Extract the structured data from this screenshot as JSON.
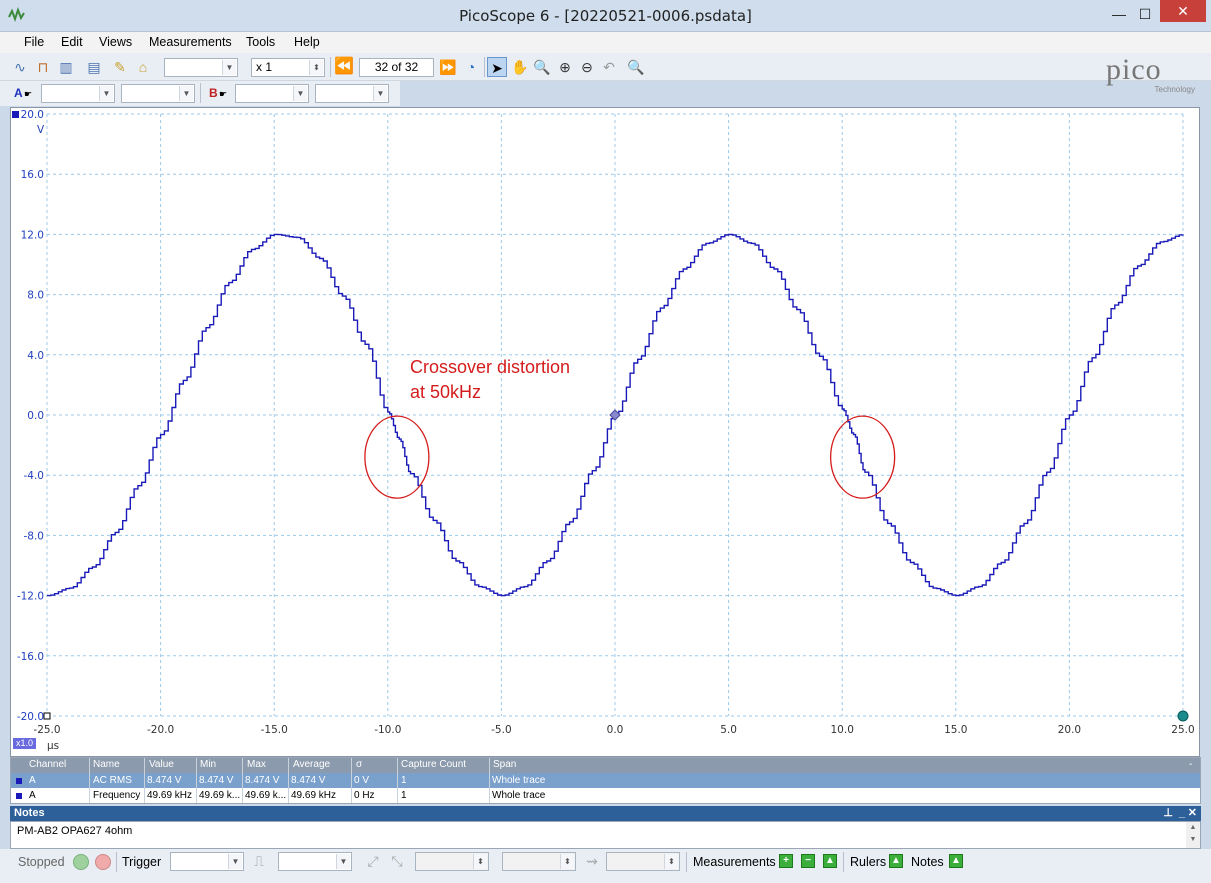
{
  "window": {
    "title": "PicoScope 6 - [20220521-0006.psdata]",
    "minimize": "—",
    "maximize": "☐",
    "close": "✕"
  },
  "menu": [
    "File",
    "Edit",
    "Views",
    "Measurements",
    "Tools",
    "Help"
  ],
  "toolbar": {
    "timebase_value": "",
    "multiplier": "x 1",
    "buffer_position": "32 of 32",
    "brand": "pico",
    "brand_sub": "Technology"
  },
  "channels": {
    "a_label": "A",
    "b_label": "B",
    "a_range": "",
    "a_coupling": "",
    "b_range": "",
    "b_coupling": ""
  },
  "chart_data": {
    "type": "line",
    "title": "",
    "xlabel": "μs",
    "ylabel": "V",
    "xlim": [
      -25,
      25
    ],
    "ylim": [
      -20,
      20
    ],
    "x_ticks": [
      "-25.0",
      "-20.0",
      "-15.0",
      "-10.0",
      "-5.0",
      "0.0",
      "5.0",
      "10.0",
      "15.0",
      "20.0",
      "25.0"
    ],
    "y_ticks": [
      "20.0",
      "16.0",
      "12.0",
      "8.0",
      "4.0",
      "0.0",
      "-4.0",
      "-8.0",
      "-12.0",
      "-16.0",
      "-20.0"
    ],
    "zoom_label": "x1.0",
    "series": [
      {
        "name": "A",
        "color": "#1a1ab8",
        "x": [
          -25,
          -24,
          -23,
          -22,
          -21,
          -20,
          -19,
          -18,
          -17,
          -16,
          -15,
          -14,
          -13,
          -12,
          -11,
          -10,
          -9.5,
          -9,
          -8,
          -7,
          -6,
          -5,
          -4,
          -3,
          -2,
          -1,
          0,
          1,
          2,
          3,
          4,
          5,
          6,
          7,
          8,
          9,
          10,
          10.5,
          11,
          12,
          13,
          14,
          15,
          16,
          17,
          18,
          19,
          20,
          21,
          22,
          23,
          24,
          25
        ],
        "y": [
          -12,
          -11.5,
          -10.1,
          -7.8,
          -4.7,
          -1.3,
          2.3,
          5.8,
          8.8,
          11.0,
          12.0,
          11.8,
          10.4,
          7.9,
          4.7,
          0.2,
          -1.6,
          -3.9,
          -7.0,
          -9.7,
          -11.4,
          -12.0,
          -11.4,
          -9.7,
          -7.1,
          -3.7,
          0.0,
          3.7,
          7.1,
          9.7,
          11.4,
          12.0,
          11.4,
          9.7,
          7.0,
          3.9,
          0.4,
          -1.3,
          -3.8,
          -7.2,
          -9.8,
          -11.5,
          -12.0,
          -11.4,
          -9.8,
          -7.2,
          -3.8,
          0.0,
          3.8,
          7.3,
          9.9,
          11.5,
          12.0
        ]
      }
    ],
    "annotation": [
      "Crossover distortion",
      "at 50kHz"
    ],
    "highlight_circles": [
      {
        "x": -9.6,
        "y": -2.8
      },
      {
        "x": 10.9,
        "y": -2.8
      }
    ],
    "center_marker": {
      "x": 0,
      "y": 0
    }
  },
  "measurements": {
    "columns": [
      "Channel",
      "Name",
      "Value",
      "Min",
      "Max",
      "Average",
      "σ",
      "Capture Count",
      "Span"
    ],
    "rows": [
      [
        "A",
        "AC RMS",
        "8.474 V",
        "8.474 V",
        "8.474 V",
        "8.474 V",
        "0 V",
        "1",
        "Whole trace"
      ],
      [
        "A",
        "Frequency",
        "49.69 kHz",
        "49.69 k...",
        "49.69 k...",
        "49.69 kHz",
        "0 Hz",
        "1",
        "Whole trace"
      ]
    ]
  },
  "notes": {
    "header": "Notes",
    "text": "PM-AB2 OPA627 4ohm"
  },
  "status": {
    "state": "Stopped",
    "trigger": "Trigger",
    "measurements": "Measurements",
    "rulers": "Rulers",
    "notes": "Notes"
  },
  "colors": {
    "trace": "#1a1ab8",
    "grid": "#9cc9e8",
    "annotation": "#d51c1c",
    "selected_row": "#7aa0cc"
  }
}
